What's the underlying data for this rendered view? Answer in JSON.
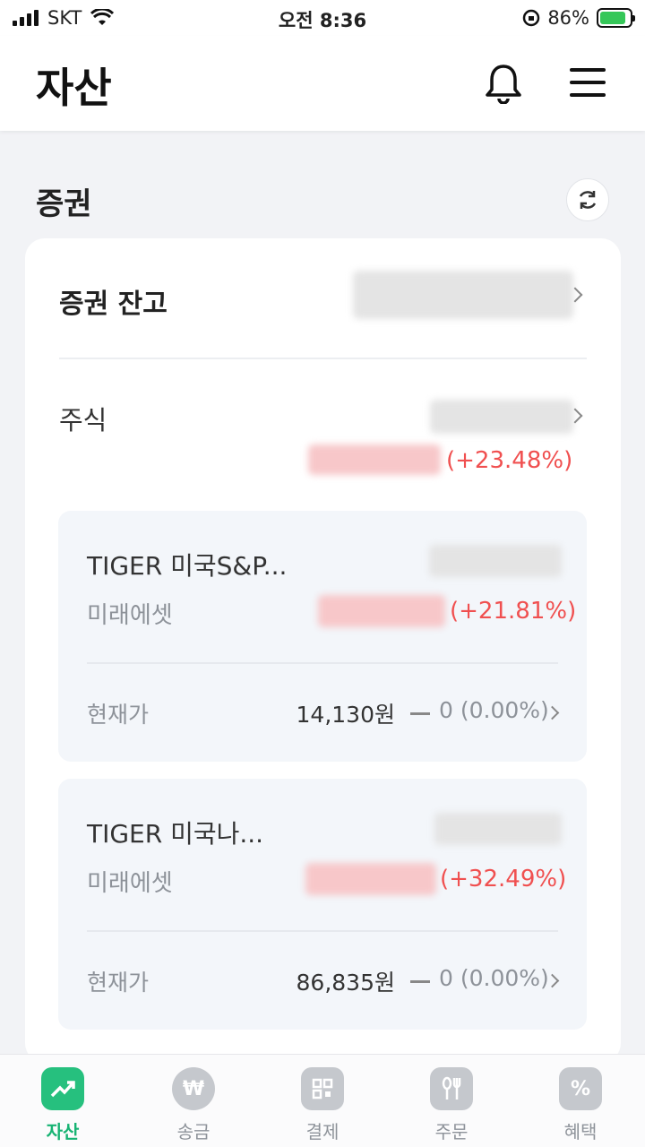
{
  "status_bar": {
    "carrier": "SKT",
    "time": "오전 8:36",
    "battery": "86%"
  },
  "header": {
    "title": "자산",
    "bell_icon": "bell-icon",
    "menu_icon": "hamburger-menu-icon"
  },
  "section": {
    "title": "증권",
    "refresh_icon": "refresh-icon"
  },
  "securities": {
    "balance_label": "증권 잔고",
    "stocks_label": "주식",
    "stocks_return": "(+23.48%)",
    "holdings": [
      {
        "name": "TIGER 미국S&P...",
        "broker": "미래에셋",
        "return": "(+21.81%)",
        "current_label": "현재가",
        "price": "14,130원",
        "change": "0 (0.00%)"
      },
      {
        "name": "TIGER 미국나...",
        "broker": "미래에셋",
        "return": "(+32.49%)",
        "current_label": "현재가",
        "price": "86,835원",
        "change": "0 (0.00%)"
      }
    ]
  },
  "bottom_nav": {
    "items": [
      {
        "label": "자산",
        "icon": "chart-up-icon",
        "active": true
      },
      {
        "label": "송금",
        "icon": "won-icon",
        "active": false
      },
      {
        "label": "결제",
        "icon": "qr-code-icon",
        "active": false
      },
      {
        "label": "주문",
        "icon": "fork-knife-icon",
        "active": false
      },
      {
        "label": "혜택",
        "icon": "coupon-icon",
        "active": false
      }
    ]
  },
  "colors": {
    "accent": "#17b373",
    "positive": "#f05050",
    "muted": "#8d9299"
  }
}
